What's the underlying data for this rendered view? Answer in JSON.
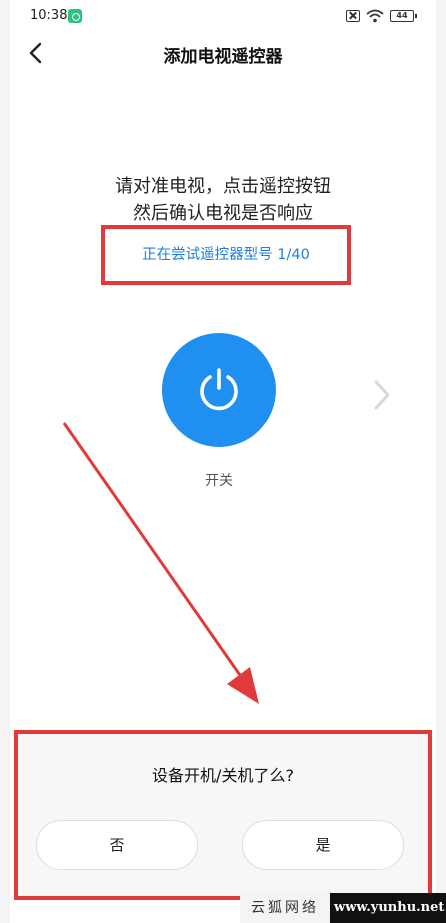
{
  "status_bar": {
    "time": "10:38",
    "battery": "44"
  },
  "header": {
    "title": "添加电视遥控器"
  },
  "instruction": {
    "line1": "请对准电视，点击遥控按钮",
    "line2": "然后确认电视是否响应"
  },
  "model_progress": "正在尝试遥控器型号 1/40",
  "power_button": {
    "label": "开关",
    "color": "#1f8ff0"
  },
  "dialog": {
    "question": "设备开机/关机了么?",
    "no_label": "否",
    "yes_label": "是"
  },
  "watermark": {
    "text": "云狐网络",
    "url": "www.yunhu.net"
  },
  "colors": {
    "accent": "#1f8ff0",
    "highlight_red": "#e03a3a"
  }
}
